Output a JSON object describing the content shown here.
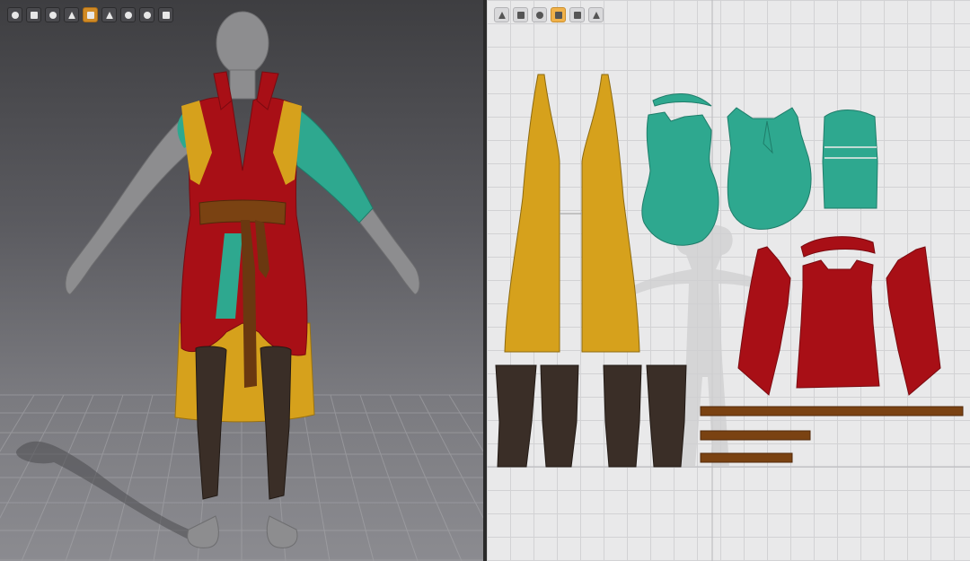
{
  "viewport3d": {
    "toolbar": [
      "render-mode-icon",
      "garment-icon",
      "texture-icon",
      "avatar-icon",
      "fabric-icon",
      "camera-icon",
      "pose-icon",
      "skin-icon",
      "export-icon"
    ],
    "active_tool": "fabric-icon",
    "colors": {
      "background_top": "#3e3e41",
      "background_bottom": "#8b8b90",
      "floor_grid": "#a9a9ad",
      "avatar": "#8d8d8f",
      "shadow": "#4b4b4f"
    }
  },
  "viewport2d": {
    "toolbar": [
      "select-icon",
      "transform-icon",
      "sewing-icon",
      "fabric-icon",
      "arrange-icon",
      "export-icon"
    ],
    "active_tool": "fabric-icon",
    "colors": {
      "background": "#e9e9ea",
      "grid": "#d2d2d4",
      "avatar_silhouette": "#cfcfd1"
    }
  },
  "garment": {
    "fabrics": [
      {
        "name": "red-fabric",
        "color": "#a80f16"
      },
      {
        "name": "yellow-fabric",
        "color": "#d6a11c"
      },
      {
        "name": "teal-fabric",
        "color": "#2ea88f"
      },
      {
        "name": "boot-fabric",
        "color": "#3a2e27"
      },
      {
        "name": "belt-fabric",
        "color": "#7a4212"
      }
    ]
  }
}
